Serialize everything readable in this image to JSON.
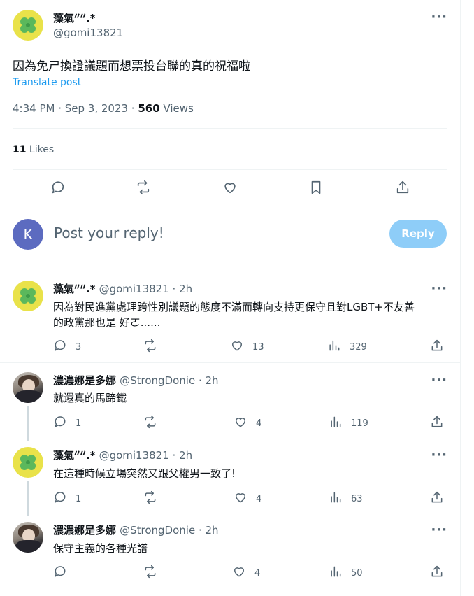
{
  "main_post": {
    "display_name": "藻氣ᐥᐥ.*",
    "handle": "@gomi13821",
    "text": "因為免ㄕ換證議題而想票投台聯的真的祝福啦",
    "translate": "Translate post",
    "timestamp": "4:34 PM · Sep 3, 2023 · ",
    "views_count": "560",
    "views_label": " Views",
    "likes_count": "11",
    "likes_label": " Likes"
  },
  "composer": {
    "avatar_letter": "K",
    "placeholder": "Post your reply!",
    "reply_button": "Reply"
  },
  "replies": [
    {
      "display_name": "藻氣ᐥᐥ.*",
      "handle": "@gomi13821 · 2h",
      "text_line1": "因為對民進黨處理跨性別議題的態度不滿而轉向支持更保守且對LGBT+不友善",
      "text_line2": "的政黨那也是 好ㄛ......",
      "replies": "3",
      "likes": "13",
      "views": "329"
    },
    {
      "display_name": "濃濃娜是多娜",
      "handle": "@StrongDonie · 2h",
      "text_line1": "就還真的馬蹄鐵",
      "replies": "1",
      "likes": "4",
      "views": "119"
    },
    {
      "display_name": "藻氣ᐥᐥ.*",
      "handle": "@gomi13821 · 2h",
      "text_line1": "在這種時候立場突然又跟父權男一致了!",
      "replies": "1",
      "likes": "4",
      "views": "63"
    },
    {
      "display_name": "濃濃娜是多娜",
      "handle": "@StrongDonie · 2h",
      "text_line1": "保守主義的各種光譜",
      "replies": "",
      "likes": "4",
      "views": "50"
    }
  ],
  "colors": {
    "accent": "#1d9bf0",
    "reply_button_disabled": "#8ecdf8",
    "composer_avatar": "#5c6bc0",
    "clover_bg": "#e9e24a"
  }
}
